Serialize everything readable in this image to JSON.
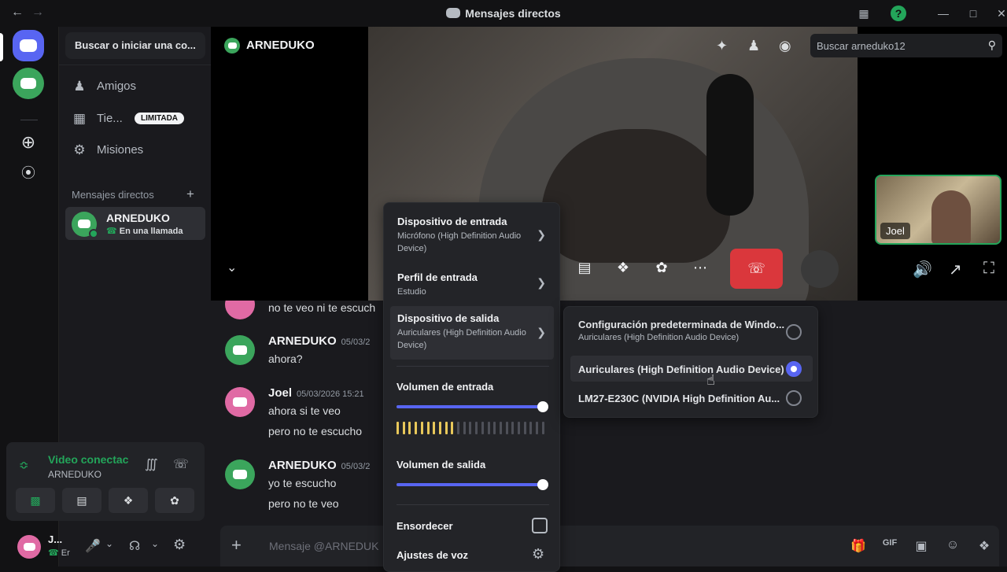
{
  "window": {
    "title": "Mensajes directos"
  },
  "sidebar": {
    "search_label": "Buscar o iniciar una co...",
    "items": [
      {
        "label": "Amigos",
        "icon": "friends-icon"
      },
      {
        "label": "Tie...",
        "badge": "LIMITADA",
        "icon": "shop-icon"
      },
      {
        "label": "Misiones",
        "icon": "quests-icon"
      }
    ],
    "dm_header": "Mensajes directos",
    "dm_add": "+",
    "dm": {
      "name": "ARNEDUKO",
      "status": "En una llamada"
    }
  },
  "voice_panel": {
    "status": "Video conectac",
    "channel": "ARNEDUKO"
  },
  "user_panel": {
    "name": "J...",
    "status": "Er"
  },
  "header": {
    "channel_name": "ARNEDUKO",
    "search_placeholder": "Buscar arneduko12"
  },
  "call": {
    "pip_name": "Joel"
  },
  "messages": [
    {
      "author": "",
      "time": "",
      "lines": [
        "no te veo ni te escuch"
      ]
    },
    {
      "author": "ARNEDUKO",
      "time": "05/03/2",
      "lines": [
        "ahora?"
      ]
    },
    {
      "author": "Joel",
      "time": "05/03/2026 15:21",
      "lines": [
        "ahora si te veo",
        "pero no te escucho"
      ]
    },
    {
      "author": "ARNEDUKO",
      "time": "05/03/2",
      "lines": [
        "yo te escucho",
        "pero no te veo"
      ]
    }
  ],
  "composer": {
    "placeholder": "Mensaje @ARNEDUK"
  },
  "voice_menu": {
    "input_device": {
      "title": "Dispositivo de entrada",
      "value": "Micrófono (High Definition Audio Device)"
    },
    "input_profile": {
      "title": "Perfil de entrada",
      "value": "Estudio"
    },
    "output_device": {
      "title": "Dispositivo de salida",
      "value": "Auriculares (High Definition Audio Device)"
    },
    "input_volume": {
      "label": "Volumen de entrada",
      "level": 1.0
    },
    "output_volume": {
      "label": "Volumen de salida",
      "level": 1.0
    },
    "deafen": {
      "label": "Ensordecer",
      "checked": false
    },
    "voice_settings": {
      "label": "Ajustes de voz"
    }
  },
  "output_submenu": [
    {
      "title": "Configuración predeterminada de Windo...",
      "sub": "Auriculares (High Definition Audio Device)",
      "selected": false
    },
    {
      "title": "Auriculares (High Definition Audio Device)",
      "sub": "",
      "selected": true
    },
    {
      "title": "LM27-E230C (NVIDIA High Definition Au...",
      "sub": "",
      "selected": false
    }
  ],
  "colors": {
    "accent": "#5865f2",
    "danger": "#da373c",
    "online": "#23a55a"
  }
}
